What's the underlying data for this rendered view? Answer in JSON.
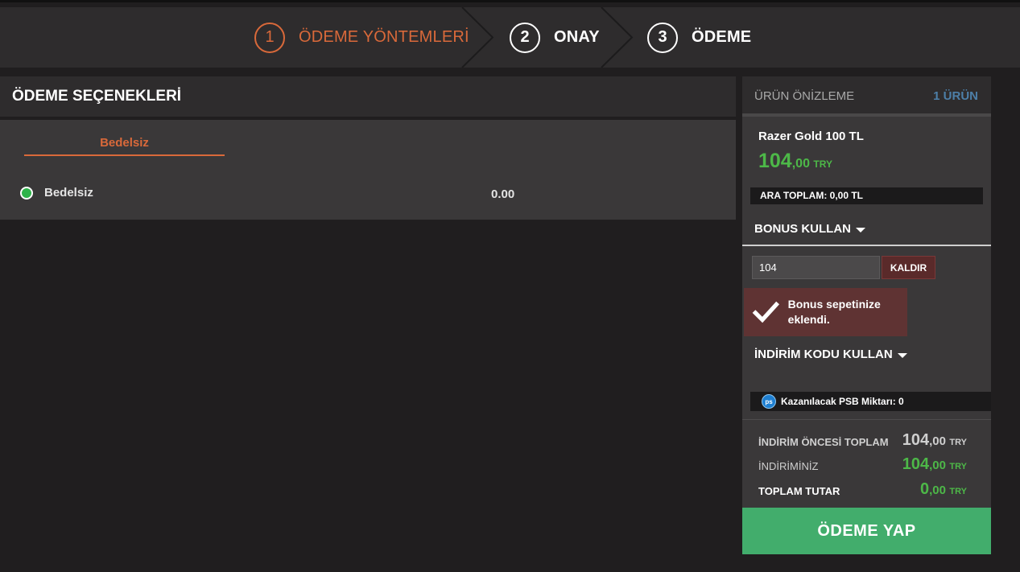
{
  "steps": [
    {
      "num": "1",
      "label": "ÖDEME YÖNTEMLERİ"
    },
    {
      "num": "2",
      "label": "ONAY"
    },
    {
      "num": "3",
      "label": "ÖDEME"
    }
  ],
  "payment": {
    "title": "ÖDEME SEÇENEKLERİ",
    "tab_label": "Bedelsiz",
    "option_label": "Bedelsiz",
    "option_price": "0.00"
  },
  "summary": {
    "title": "ÜRÜN ÖNİZLEME",
    "count": "1 ÜRÜN",
    "product_name": "Razer Gold 100 TL",
    "price_int": "104",
    "price_dec": ",00",
    "price_cur": "TRY",
    "subtotal": "ARA TOPLAM: 0,00 TL",
    "bonus_title": "BONUS KULLAN",
    "bonus_value": "104",
    "remove_label": "KALDIR",
    "notice": "Bonus sepetinize eklendi.",
    "discount_title": "İNDİRİM KODU KULLAN",
    "psb_icon_text": "ps",
    "psb_text": "Kazanılacak PSB Miktarı: 0",
    "totals": [
      {
        "label": "İNDİRİM ÖNCESİ TOPLAM",
        "int": "104",
        "dec": ",00",
        "cur": "TRY"
      },
      {
        "label": "İNDİRİMİNİZ",
        "int": "104",
        "dec": ",00",
        "cur": "TRY"
      },
      {
        "label": "TOPLAM TUTAR",
        "int": "0",
        "dec": ",00",
        "cur": "TRY"
      }
    ],
    "pay_label": "ÖDEME YAP"
  },
  "colors": {
    "accent": "#d9693a",
    "green": "#4db848",
    "pay_button": "#42ad6c",
    "notice_bg": "#5f3333",
    "count_blue": "#4d7fa8"
  }
}
